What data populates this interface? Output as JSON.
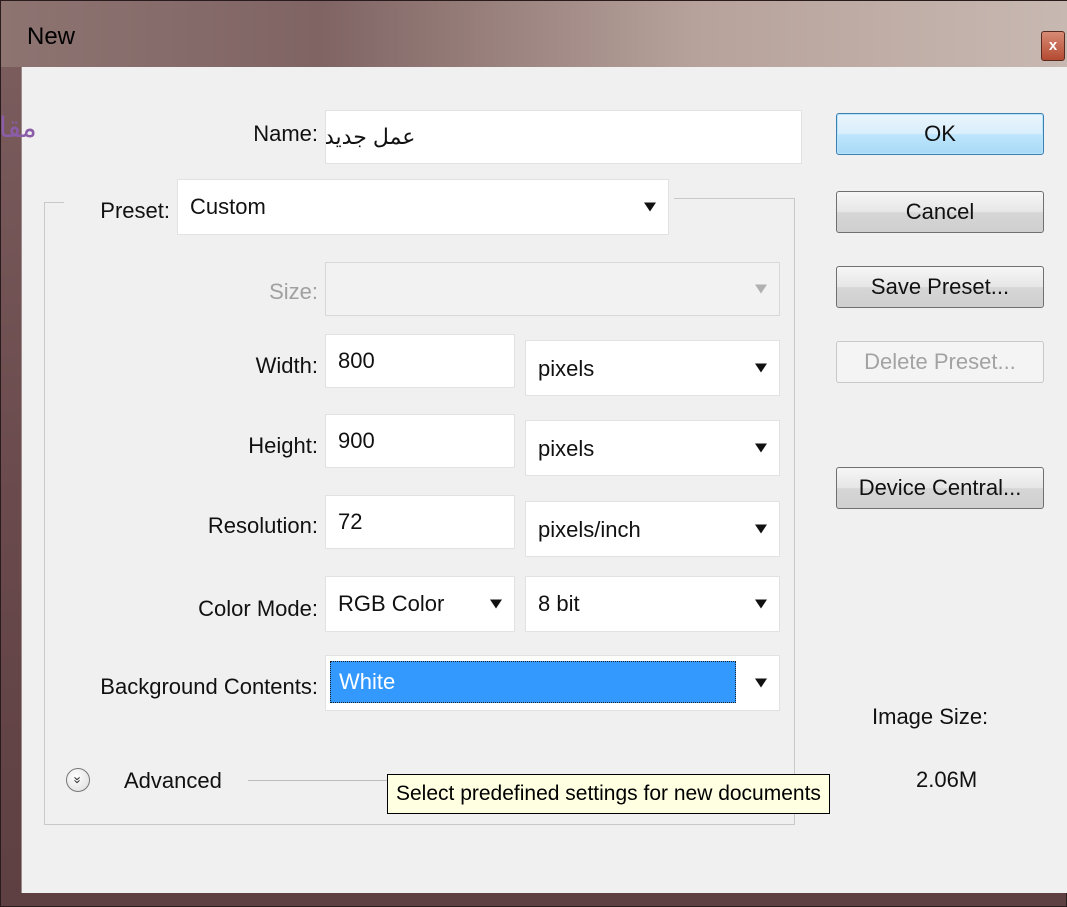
{
  "window": {
    "title": "New",
    "close_glyph": "x"
  },
  "form": {
    "name_label": "Name:",
    "name_value": "عمل جديد",
    "preset_label": "Preset:",
    "preset_value": "Custom",
    "size_label": "Size:",
    "size_value": "",
    "width_label": "Width:",
    "width_value": "800",
    "width_unit": "pixels",
    "height_label": "Height:",
    "height_value": "900",
    "height_unit": "pixels",
    "resolution_label": "Resolution:",
    "resolution_value": "72",
    "resolution_unit": "pixels/inch",
    "color_mode_label": "Color Mode:",
    "color_mode_value": "RGB Color",
    "bit_depth_value": "8 bit",
    "background_label": "Background Contents:",
    "background_value": "White",
    "advanced_label": "Advanced",
    "advanced_glyph": "»"
  },
  "buttons": {
    "ok": "OK",
    "cancel": "Cancel",
    "save_preset": "Save Preset...",
    "delete_preset": "Delete Preset...",
    "device_central": "Device Central..."
  },
  "info": {
    "image_size_label": "Image Size:",
    "image_size_value": "2.06M"
  },
  "tooltip": "Select predefined settings for new documents",
  "watermark_text": "مقا",
  "colors": {
    "selection": "#3399ff",
    "ok_border": "#3c7fb1",
    "tooltip_bg": "#ffffe1",
    "watermark": "#8b5ca8"
  }
}
